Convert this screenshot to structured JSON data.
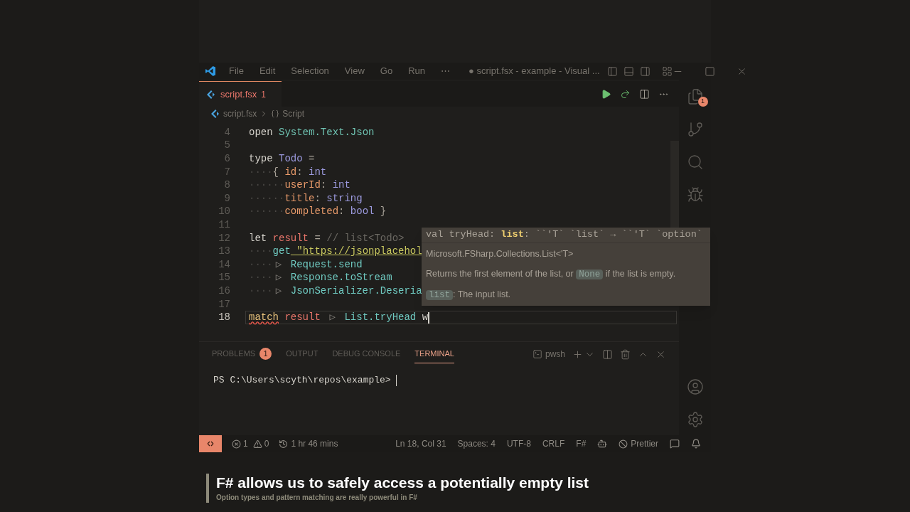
{
  "title_bar": {
    "menus": [
      "File",
      "Edit",
      "Selection",
      "View",
      "Go",
      "Run",
      "⋯"
    ],
    "title": "● script.fsx - example - Visual ..."
  },
  "editor_tab": {
    "label": "script.fsx",
    "problems": "1",
    "modified": true,
    "selected": true
  },
  "breadcrumbs": [
    "script.fsx",
    "Script"
  ],
  "activity_bar": {
    "explorer_badge": "1"
  },
  "code": {
    "lines": [
      {
        "number": "4",
        "current": false,
        "tokens": [
          {
            "text": "open ",
            "kind": "kw"
          },
          {
            "text": "System.Text.Json",
            "kind": "ns"
          }
        ]
      },
      {
        "number": "5",
        "current": false
      },
      {
        "number": "6",
        "current": false,
        "tokens": [
          {
            "text": "type ",
            "kind": "kw"
          },
          {
            "text": "Todo",
            "kind": "type"
          },
          {
            "text": " =",
            "kind": "punct"
          }
        ]
      },
      {
        "number": "7",
        "current": false,
        "tokens": [
          {
            "text": "····",
            "kind": "ws"
          },
          {
            "text": "{ ",
            "kind": "punct"
          },
          {
            "text": "id",
            "kind": "field"
          },
          {
            "text": ": ",
            "kind": "punct"
          },
          {
            "text": "int",
            "kind": "type"
          }
        ]
      },
      {
        "number": "8",
        "current": false,
        "tokens": [
          {
            "text": "······",
            "kind": "ws"
          },
          {
            "text": "userId",
            "kind": "field"
          },
          {
            "text": ": ",
            "kind": "punct"
          },
          {
            "text": "int",
            "kind": "type"
          }
        ]
      },
      {
        "number": "9",
        "current": false,
        "tokens": [
          {
            "text": "······",
            "kind": "ws"
          },
          {
            "text": "title",
            "kind": "field"
          },
          {
            "text": ": ",
            "kind": "punct"
          },
          {
            "text": "string",
            "kind": "type"
          }
        ]
      },
      {
        "number": "10",
        "current": false,
        "tokens": [
          {
            "text": "······",
            "kind": "ws"
          },
          {
            "text": "completed",
            "kind": "field"
          },
          {
            "text": ": ",
            "kind": "punct"
          },
          {
            "text": "bool",
            "kind": "type"
          },
          {
            "text": " }",
            "kind": "punct"
          }
        ]
      },
      {
        "number": "11",
        "current": false
      },
      {
        "number": "12",
        "current": false,
        "tokens": [
          {
            "text": "let ",
            "kind": "kw"
          },
          {
            "text": "result",
            "kind": "var"
          },
          {
            "text": " = ",
            "kind": "punct"
          },
          {
            "text": "// list<Todo>",
            "kind": "comment"
          }
        ]
      },
      {
        "number": "13",
        "current": false,
        "tokens": [
          {
            "text": "····",
            "kind": "ws"
          },
          {
            "text": "get",
            "kind": "fn"
          },
          {
            "text": " \"https://jsonplacehol",
            "kind": "str"
          }
        ]
      },
      {
        "number": "14",
        "current": false,
        "tokens": [
          {
            "text": "····",
            "kind": "ws"
          },
          {
            "text": "▷",
            "kind": "pipe"
          },
          {
            "text": " Request.send",
            "kind": "fn"
          }
        ]
      },
      {
        "number": "15",
        "current": false,
        "tokens": [
          {
            "text": "····",
            "kind": "ws"
          },
          {
            "text": "▷",
            "kind": "pipe"
          },
          {
            "text": " Response.toStream",
            "kind": "fn"
          }
        ]
      },
      {
        "number": "16",
        "current": false,
        "tokens": [
          {
            "text": "····",
            "kind": "ws"
          },
          {
            "text": "▷",
            "kind": "pipe"
          },
          {
            "text": " JsonSerializer.Deseria",
            "kind": "fn"
          }
        ]
      },
      {
        "number": "17",
        "current": false
      },
      {
        "number": "18",
        "current": true,
        "tokens": [
          {
            "text": "match",
            "kind": "error"
          },
          {
            "text": " result ",
            "kind": "var"
          },
          {
            "text": "▷",
            "kind": "pipe"
          },
          {
            "text": " List.tryHead",
            "kind": "fn"
          },
          {
            "text": " w",
            "kind": "plain"
          }
        ]
      }
    ]
  },
  "hover": {
    "signature": [
      {
        "text": "val tryHead: ",
        "kind": "plain"
      },
      {
        "text": "list",
        "kind": "param"
      },
      {
        "text": ": ``'T` `list` → ``'T` `option`",
        "kind": "plain"
      }
    ],
    "namespace": "Microsoft.FSharp.Collections.List<'T>",
    "paragraphs": [
      [
        {
          "text": "Returns the first element of the list, or ",
          "kind": "plain"
        },
        {
          "text": "None",
          "kind": "code"
        },
        {
          "text": " if the list is empty.",
          "kind": "plain"
        }
      ],
      [
        {
          "text": "list",
          "kind": "code"
        },
        {
          "text": ": The input list.",
          "kind": "plain"
        }
      ]
    ]
  },
  "panel": {
    "tabs": [
      {
        "label": "PROBLEMS",
        "badge": "1",
        "selected": false
      },
      {
        "label": "OUTPUT",
        "selected": false
      },
      {
        "label": "DEBUG CONSOLE",
        "selected": false
      },
      {
        "label": "TERMINAL",
        "selected": true
      }
    ],
    "shell": "pwsh",
    "prompt": "PS C:\\Users\\scyth\\repos\\example> "
  },
  "status_bar": {
    "errors": "1",
    "warnings": "0",
    "time": "1 hr 46 mins",
    "items": [
      "Ln 18, Col 31",
      "Spaces: 4",
      "UTF-8",
      "CRLF",
      "F#"
    ],
    "formatter": "Prettier"
  },
  "caption": {
    "title": "F# allows us to safely access a potentially empty list",
    "subtitle": "Option types and pattern matching are really powerful in F#"
  }
}
